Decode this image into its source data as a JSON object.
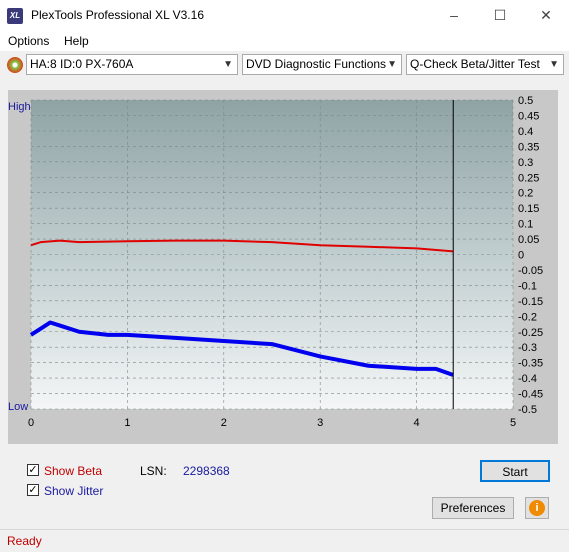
{
  "window": {
    "title": "PlexTools Professional XL V3.16",
    "icon_text": "XL"
  },
  "menu": {
    "options": "Options",
    "help": "Help"
  },
  "toolbar": {
    "drive": "HA:8 ID:0  PX-760A",
    "function": "DVD Diagnostic Functions",
    "test": "Q-Check Beta/Jitter Test"
  },
  "chart_data": {
    "type": "line",
    "left_axis_labels": {
      "top": "High",
      "bottom": "Low"
    },
    "x_ticks": [
      "0",
      "1",
      "2",
      "3",
      "4",
      "5"
    ],
    "xlim": [
      0,
      5
    ],
    "y_ticks": [
      "0.5",
      "0.45",
      "0.4",
      "0.35",
      "0.3",
      "0.25",
      "0.2",
      "0.15",
      "0.1",
      "0.05",
      "0",
      "-0.05",
      "-0.1",
      "-0.15",
      "-0.2",
      "-0.25",
      "-0.3",
      "-0.35",
      "-0.4",
      "-0.45",
      "-0.5"
    ],
    "ylim": [
      -0.5,
      0.5
    ],
    "end_marker_x": 4.38,
    "grid": true,
    "series": [
      {
        "color": "#e00000",
        "x": [
          0,
          0.1,
          0.3,
          0.5,
          1.0,
          1.5,
          2.0,
          2.5,
          3.0,
          3.5,
          4.0,
          4.38
        ],
        "y": [
          0.03,
          0.04,
          0.045,
          0.04,
          0.043,
          0.045,
          0.045,
          0.04,
          0.03,
          0.025,
          0.02,
          0.01
        ]
      },
      {
        "color": "#0000ee",
        "x": [
          0,
          0.1,
          0.2,
          0.3,
          0.5,
          0.8,
          1.0,
          1.5,
          2.0,
          2.5,
          3.0,
          3.5,
          4.0,
          4.2,
          4.38
        ],
        "y": [
          -0.26,
          -0.24,
          -0.22,
          -0.23,
          -0.25,
          -0.26,
          -0.26,
          -0.27,
          -0.28,
          -0.29,
          -0.33,
          -0.36,
          -0.37,
          -0.37,
          -0.39
        ]
      }
    ]
  },
  "controls": {
    "show_beta": "Show Beta",
    "show_jitter": "Show Jitter",
    "lsn_label": "LSN:",
    "lsn_value": "2298368",
    "start": "Start",
    "preferences": "Preferences",
    "info_icon": "i"
  },
  "status": {
    "text": "Ready"
  }
}
